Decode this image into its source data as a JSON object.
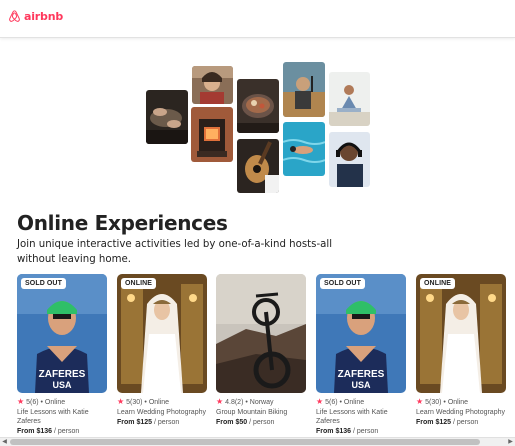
{
  "header": {
    "logo_text": "airbnb",
    "brand_color": "#ff385c"
  },
  "hero": {
    "image_tiles": 10
  },
  "section": {
    "title": "Online Experiences",
    "subtitle": "Join unique interactive activities led by one-of-a-kind hosts-all without leaving home."
  },
  "cards": [
    {
      "badge": "SOLD OUT",
      "rating": "5(6)",
      "location": "Online",
      "title": "Life Lessons with Katie Zaferes",
      "price": "From $136",
      "unit": "/ person",
      "image": "athlete"
    },
    {
      "badge": "ONLINE",
      "rating": "5(30)",
      "location": "Online",
      "title": "Learn Wedding Photography",
      "price": "From $125",
      "unit": "/ person",
      "image": "bride"
    },
    {
      "badge": "",
      "rating": "4.8(2)",
      "location": "Norway",
      "title": "Group Mountain Biking",
      "price": "From $50",
      "unit": "/ person",
      "image": "bike"
    },
    {
      "badge": "SOLD OUT",
      "rating": "5(6)",
      "location": "Online",
      "title": "Life Lessons with Katie Zaferes",
      "price": "From $136",
      "unit": "/ person",
      "image": "athlete"
    },
    {
      "badge": "ONLINE",
      "rating": "5(30)",
      "location": "Online",
      "title": "Learn Wedding Photography",
      "price": "From $125",
      "unit": "/ person",
      "image": "bride"
    }
  ],
  "scroll": {
    "left_arrow": "◀",
    "right_arrow": "▶"
  }
}
